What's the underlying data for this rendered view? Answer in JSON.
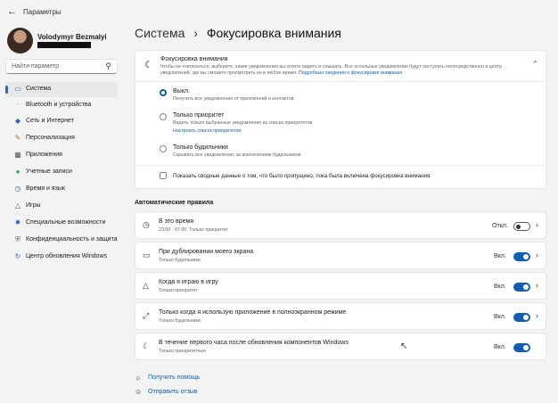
{
  "window": {
    "title": "Параметры",
    "back_icon": "arrow-left-icon"
  },
  "user": {
    "name": "Volodymyr Bezmalyi"
  },
  "search": {
    "placeholder": "Найти параметр"
  },
  "sidebar": {
    "items": [
      {
        "label": "Система",
        "icon": "system-icon",
        "active": true
      },
      {
        "label": "Bluetooth и устройства",
        "icon": "bluetooth-icon"
      },
      {
        "label": "Сеть и Интернет",
        "icon": "wifi-icon"
      },
      {
        "label": "Персонализация",
        "icon": "brush-icon"
      },
      {
        "label": "Приложения",
        "icon": "apps-icon"
      },
      {
        "label": "Учетные записи",
        "icon": "accounts-icon"
      },
      {
        "label": "Время и язык",
        "icon": "globe-icon"
      },
      {
        "label": "Игры",
        "icon": "gamepad-icon"
      },
      {
        "label": "Специальные возможности",
        "icon": "accessibility-icon"
      },
      {
        "label": "Конфиденциальность и защита",
        "icon": "shield-icon"
      },
      {
        "label": "Центр обновления Windows",
        "icon": "update-icon"
      }
    ]
  },
  "breadcrumb": {
    "parent": "Система",
    "separator": "›",
    "current": "Фокусировка внимания"
  },
  "focus": {
    "title": "Фокусировка внимания",
    "description1": "Чтобы не отвлекаться, выберите, какие уведомления вы хотите видеть и слышать. Все остальные уведомления будут поступать непосредственно в центр",
    "description2": "уведомлений, где вы сможете просмотреть их в любое время.",
    "learn_more": "Подробные сведения о фокусировке внимания",
    "options": [
      {
        "label": "Выкл.",
        "desc": "Получать все уведомления от приложений и контактов",
        "selected": true
      },
      {
        "label": "Только приоритет",
        "desc": "Видеть только выбранные уведомления из списка приоритетов",
        "link": "Настроить список приоритетов"
      },
      {
        "label": "Только будильники",
        "desc": "Скрывать все уведомления, за исключением будильников"
      }
    ],
    "summary_checkbox": "Показать сводные данные о том, что было пропущено, пока была включена фокусировка внимания"
  },
  "rules": {
    "heading": "Автоматические правила",
    "items": [
      {
        "title": "В это время",
        "sub": "23:00 - 07:00; Только приоритет",
        "state": "Откл.",
        "on": false,
        "icon": "clock-icon"
      },
      {
        "title": "При дублировании моего экрана",
        "sub": "Только будильники",
        "state": "Вкл.",
        "on": true,
        "icon": "monitor-icon"
      },
      {
        "title": "Когда я играю в игру",
        "sub": "Только приоритет",
        "state": "Вкл.",
        "on": true,
        "icon": "gamepad-icon"
      },
      {
        "title": "Только когда я использую приложение в полноэкранном режиме",
        "sub": "Только будильники",
        "state": "Вкл.",
        "on": true,
        "icon": "fullscreen-icon"
      },
      {
        "title": "В течение первого часа после обновления компонентов Windows",
        "sub": "Только приоритетные",
        "state": "Вкл.",
        "on": true,
        "icon": "moon-icon"
      }
    ]
  },
  "footer": {
    "help": "Получить помощь",
    "feedback": "Отправить отзыв"
  },
  "colors": {
    "accent": "#0f5fb5",
    "background": "#f3f3f3",
    "card": "#ffffff"
  }
}
